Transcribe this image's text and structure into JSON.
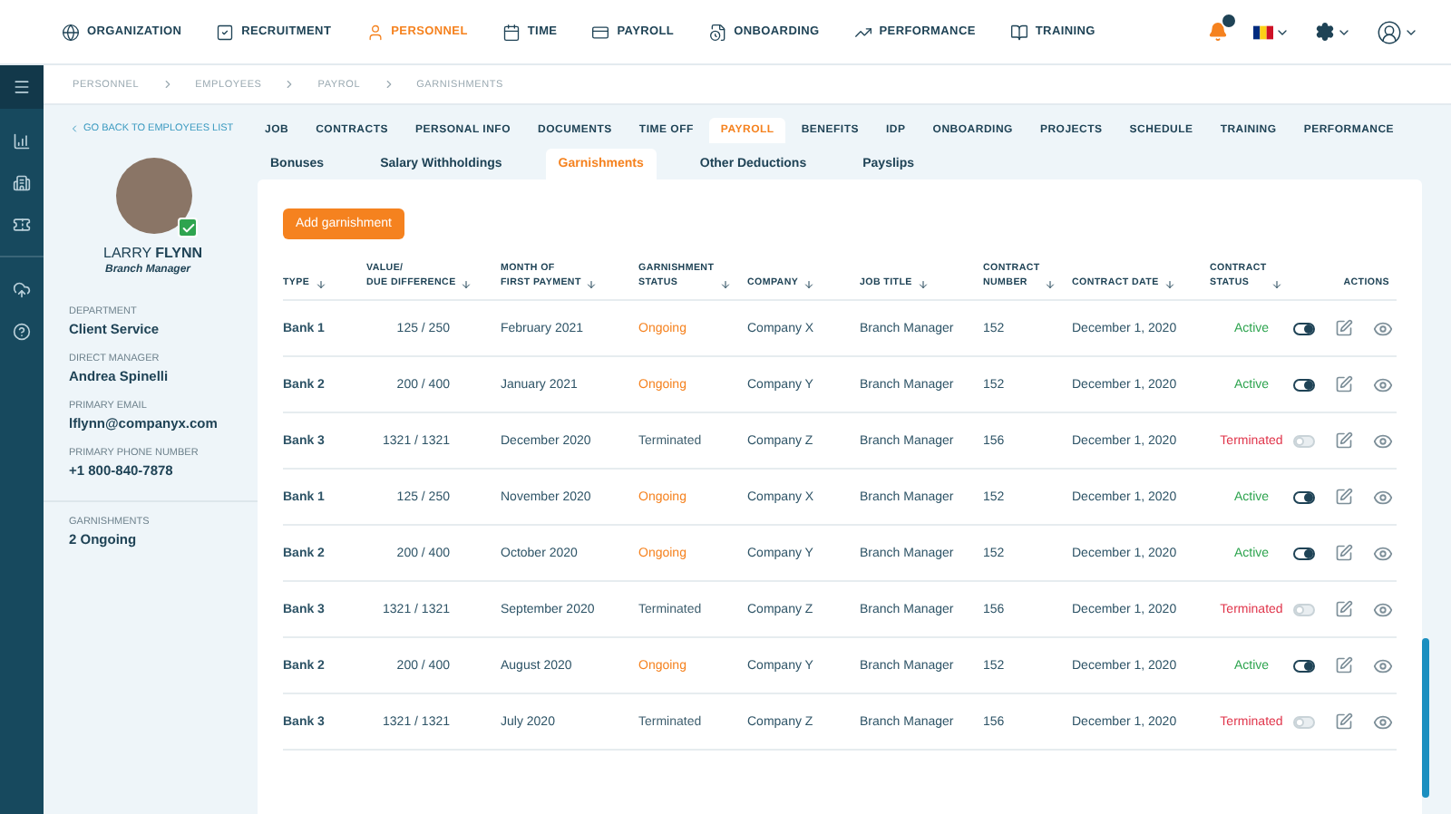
{
  "top_nav": [
    {
      "label": "ORGANIZATION",
      "selected": false
    },
    {
      "label": "RECRUITMENT",
      "selected": false
    },
    {
      "label": "PERSONNEL",
      "selected": true
    },
    {
      "label": "TIME",
      "selected": false
    },
    {
      "label": "PAYROLL",
      "selected": false
    },
    {
      "label": "ONBOARDING",
      "selected": false
    },
    {
      "label": "PERFORMANCE",
      "selected": false
    },
    {
      "label": "TRAINING",
      "selected": false
    }
  ],
  "breadcrumb": [
    "PERSONNEL",
    "EMPLOYEES",
    "PAYROL",
    "GARNISHMENTS"
  ],
  "back_link": "GO BACK TO EMPLOYEES LIST",
  "profile": {
    "first_name": "LARRY",
    "last_name": "FLYNN",
    "role": "Branch Manager",
    "verified": true,
    "fields": [
      {
        "label": "DEPARTMENT",
        "value": "Client Service"
      },
      {
        "label": "DIRECT MANAGER",
        "value": "Andrea Spinelli"
      },
      {
        "label": "PRIMARY EMAIL",
        "value": "lflynn@companyx.com"
      },
      {
        "label": "PRIMARY PHONE NUMBER",
        "value": "+1 800-840-7878"
      }
    ],
    "summary": {
      "label": "GARNISHMENTS",
      "value": "2 Ongoing"
    }
  },
  "tabs": [
    {
      "label": "JOB",
      "selected": false
    },
    {
      "label": "CONTRACTS",
      "selected": false
    },
    {
      "label": "PERSONAL INFO",
      "selected": false
    },
    {
      "label": "DOCUMENTS",
      "selected": false
    },
    {
      "label": "TIME OFF",
      "selected": false
    },
    {
      "label": "PAYROLL",
      "selected": true
    },
    {
      "label": "BENEFITS",
      "selected": false
    },
    {
      "label": "IDP",
      "selected": false
    },
    {
      "label": "ONBOARDING",
      "selected": false
    },
    {
      "label": "PROJECTS",
      "selected": false
    },
    {
      "label": "SCHEDULE",
      "selected": false
    },
    {
      "label": "TRAINING",
      "selected": false
    },
    {
      "label": "PERFORMANCE",
      "selected": false
    }
  ],
  "subtabs": [
    {
      "label": "Bonuses",
      "selected": false
    },
    {
      "label": "Salary Withholdings",
      "selected": false
    },
    {
      "label": "Garnishments",
      "selected": true
    },
    {
      "label": "Other Deductions",
      "selected": false
    },
    {
      "label": "Payslips",
      "selected": false
    }
  ],
  "add_button": "Add garnishment",
  "table": {
    "columns": [
      [
        "TYPE"
      ],
      [
        "VALUE/",
        "DUE DIFFERENCE"
      ],
      [
        "MONTH OF",
        "FIRST PAYMENT"
      ],
      [
        "GARNISHMENT",
        "STATUS"
      ],
      [
        "COMPANY"
      ],
      [
        "JOB TITLE"
      ],
      [
        "CONTRACT",
        "NUMBER"
      ],
      [
        "CONTRACT DATE"
      ],
      [
        "CONTRACT",
        "STATUS"
      ]
    ],
    "actions_heading": "ACTIONS",
    "rows": [
      {
        "type": "Bank 1",
        "value": "125 / 250",
        "month": "February 2021",
        "status": {
          "text": "Ongoing",
          "kind": "ongoing"
        },
        "company": "Company X",
        "job": "Branch Manager",
        "number": "152",
        "date": "December 1, 2020",
        "contract_status": {
          "text": "Active",
          "kind": "active"
        },
        "on": true
      },
      {
        "type": "Bank 2",
        "value": "200 / 400",
        "month": "January 2021",
        "status": {
          "text": "Ongoing",
          "kind": "ongoing"
        },
        "company": "Company Y",
        "job": "Branch Manager",
        "number": "152",
        "date": "December 1, 2020",
        "contract_status": {
          "text": "Active",
          "kind": "active"
        },
        "on": true
      },
      {
        "type": "Bank 3",
        "value": "1321 / 1321",
        "month": "December 2020",
        "status": {
          "text": "Terminated",
          "kind": "terminated"
        },
        "company": "Company Z",
        "job": "Branch Manager",
        "number": "156",
        "date": "December 1, 2020",
        "contract_status": {
          "text": "Terminated",
          "kind": "terminated"
        },
        "on": false
      },
      {
        "type": "Bank 1",
        "value": "125 / 250",
        "month": "November 2020",
        "status": {
          "text": "Ongoing",
          "kind": "ongoing"
        },
        "company": "Company X",
        "job": "Branch Manager",
        "number": "152",
        "date": "December 1, 2020",
        "contract_status": {
          "text": "Active",
          "kind": "active"
        },
        "on": true
      },
      {
        "type": "Bank 2",
        "value": "200 / 400",
        "month": "October 2020",
        "status": {
          "text": "Ongoing",
          "kind": "ongoing"
        },
        "company": "Company Y",
        "job": "Branch Manager",
        "number": "152",
        "date": "December 1, 2020",
        "contract_status": {
          "text": "Active",
          "kind": "active"
        },
        "on": true
      },
      {
        "type": "Bank 3",
        "value": "1321 / 1321",
        "month": "September 2020",
        "status": {
          "text": "Terminated",
          "kind": "terminated"
        },
        "company": "Company Z",
        "job": "Branch Manager",
        "number": "156",
        "date": "December 1, 2020",
        "contract_status": {
          "text": "Terminated",
          "kind": "terminated"
        },
        "on": false
      },
      {
        "type": "Bank 2",
        "value": "200 / 400",
        "month": "August 2020",
        "status": {
          "text": "Ongoing",
          "kind": "ongoing"
        },
        "company": "Company Y",
        "job": "Branch Manager",
        "number": "152",
        "date": "December 1, 2020",
        "contract_status": {
          "text": "Active",
          "kind": "active"
        },
        "on": true
      },
      {
        "type": "Bank 3",
        "value": "1321 / 1321",
        "month": "July 2020",
        "status": {
          "text": "Terminated",
          "kind": "terminated"
        },
        "company": "Company Z",
        "job": "Branch Manager",
        "number": "156",
        "date": "December 1, 2020",
        "contract_status": {
          "text": "Terminated",
          "kind": "terminated"
        },
        "on": false
      }
    ]
  }
}
